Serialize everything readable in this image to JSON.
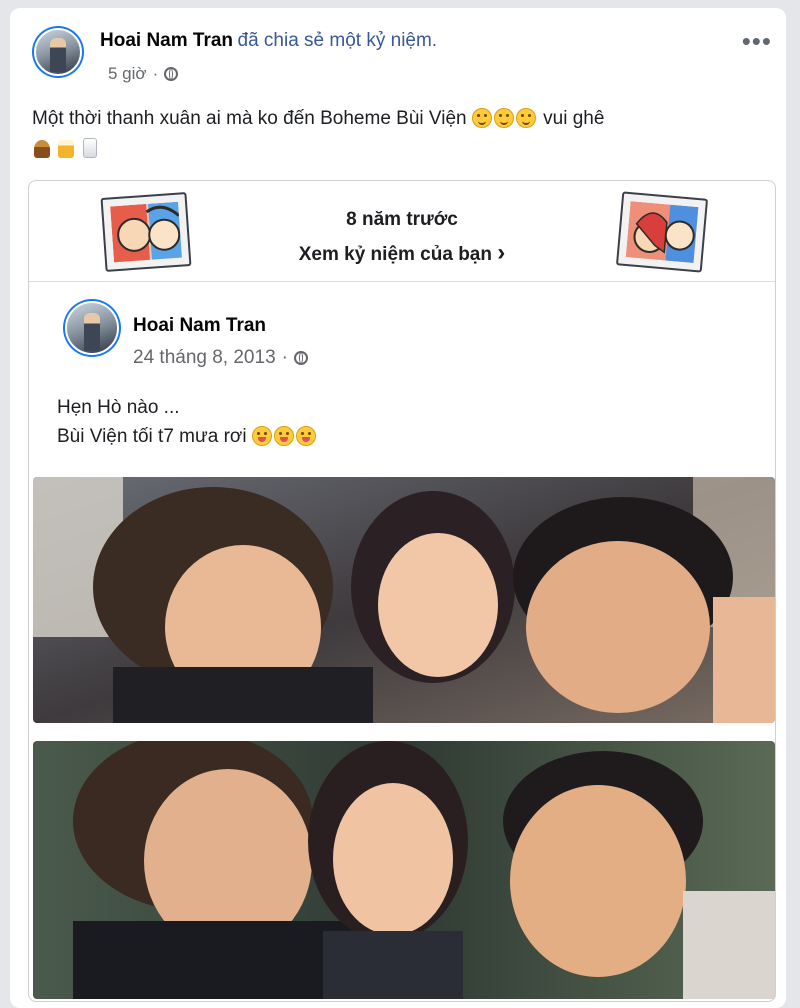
{
  "post": {
    "author": "Hoai Nam Tran",
    "action": "đã chia sẻ một kỷ niệm.",
    "time": "5 giờ",
    "text": "Một thời thanh xuân ai mà ko đến Boheme Bùi Viện",
    "text_suffix": "vui ghê",
    "more_icon": "more-dots-icon",
    "audience_icon": "globe-icon"
  },
  "memory": {
    "years_ago": "8 năm trước",
    "view_label": "Xem kỷ niệm của bạn",
    "chevron": "›",
    "original": {
      "author": "Hoai Nam Tran",
      "date": "24 tháng 8, 2013",
      "line1": "Hẹn Hò nào ...",
      "line2": "Bùi Viện tối t7 mưa rơi"
    }
  },
  "colors": {
    "link": "#385898",
    "meta": "#65676b",
    "accent": "#1877f2"
  }
}
